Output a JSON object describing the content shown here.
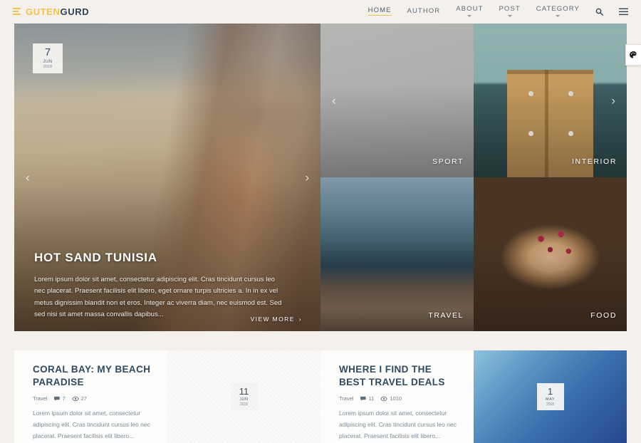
{
  "brand": {
    "part1": "GUTEN",
    "part2": "GURD"
  },
  "nav": {
    "items": [
      {
        "label": "HOME",
        "has_dropdown": false,
        "active": true
      },
      {
        "label": "AUTHOR",
        "has_dropdown": false,
        "active": false
      },
      {
        "label": "ABOUT",
        "has_dropdown": true,
        "active": false
      },
      {
        "label": "POST",
        "has_dropdown": true,
        "active": false
      },
      {
        "label": "CATEGORY",
        "has_dropdown": true,
        "active": false
      }
    ],
    "search_icon": "search-icon",
    "menu_icon": "hamburger-menu-icon"
  },
  "side_tab": {
    "icon": "palette-icon"
  },
  "hero": {
    "date": {
      "day": "7",
      "month": "JUN",
      "year": "2018"
    },
    "title": "HOT SAND TUNISIA",
    "excerpt": "Lorem ipsum dolor sit amet, consectetur adipiscing elit. Cras tincidunt cursus leo nec placerat. Praesent facilisis elit libero, eget ornare turpis ultricies a. In in ex vel metus dignissim blandit non et eros. Integer ac viverra diam, nec euismod est. Sed sed nisi sit amet massa convallis dapibus...",
    "view_more": "VIEW MORE",
    "arrow_prev": "‹",
    "arrow_next": "›",
    "tiles": [
      {
        "category": "SPORT"
      },
      {
        "category": "INTERIOR"
      },
      {
        "category": "TRAVEL"
      },
      {
        "category": "FOOD"
      }
    ]
  },
  "posts": [
    {
      "title": "CORAL BAY: MY BEACH PARADISE",
      "category": "Travel",
      "comments": "7",
      "views": "27",
      "excerpt": "Lorem ipsum dolor sit amet, consectetur adipiscing elit. Cras tincidunt cursus leo nec placerat. Praesent facilisis elit libero...",
      "date": {
        "day": "11",
        "month": "JUN",
        "year": "2018"
      }
    },
    {
      "title": "WHERE I FIND THE BEST TRAVEL DEALS",
      "category": "Travel",
      "comments": "11",
      "views": "1010",
      "excerpt": "Lorem ipsum dolor sit amet, consectetur adipiscing elit. Cras tincidunt cursus leo nec placerat. Praesent facilisis elit libero...",
      "date": {
        "day": "1",
        "month": "MAY",
        "year": "2018"
      }
    }
  ],
  "colors": {
    "accent": "#f2c14e",
    "heading": "#2f4a63",
    "page_bg": "#f4f1ec",
    "card_bg": "#fcfcfb"
  }
}
